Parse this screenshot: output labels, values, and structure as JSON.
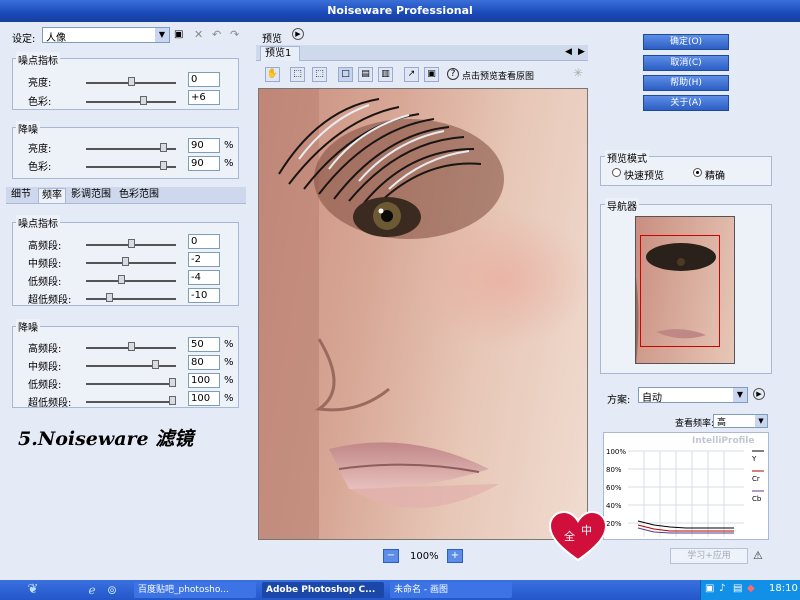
{
  "window": {
    "title": "Noiseware Professional"
  },
  "left": {
    "settings_label": "设定:",
    "preset_value": "人像",
    "noise_level_group": "噪点指标",
    "noise_reduction_group": "降噪",
    "luminance": "亮度:",
    "color": "色彩:",
    "noise_luminance_value": "0",
    "noise_color_value": "+6",
    "reduction_luminance_value": "90",
    "reduction_color_value": "90",
    "percent": "%",
    "tabs": [
      "细节",
      "频率",
      "影调范围",
      "色彩范围"
    ],
    "freq_noise_group": "噪点指标",
    "freq_reduction_group": "降噪",
    "high": "高频段:",
    "mid": "中频段:",
    "low": "低频段:",
    "ultra_low": "超低频段:",
    "freq_noise_values": [
      "0",
      "-2",
      "-4",
      "-10"
    ],
    "freq_reduction_values": [
      "50",
      "80",
      "100",
      "100"
    ],
    "caption": "5.Noiseware 滤镜"
  },
  "preview": {
    "header": "预览",
    "tab": "预览1",
    "hint": "点击预览查看原图",
    "zoom": "100%"
  },
  "right": {
    "buttons": [
      "确定(O)",
      "取消(C)",
      "帮助(H)",
      "关于(A)"
    ],
    "mode_group": "预览模式",
    "fast_preview": "快速预览",
    "accurate": "精确",
    "navigator": "导航器",
    "scheme_label": "方案:",
    "scheme_value": "自动",
    "freq_label": "查看频率:",
    "freq_value": "高",
    "graph_title": "IntelliProfile",
    "y_ticks": [
      "100%",
      "80%",
      "60%",
      "40%",
      "20%"
    ],
    "legend": [
      "Y",
      "Cr",
      "Cb"
    ],
    "learn_button": "学习+应用"
  },
  "taskbar": {
    "tasks": [
      "百度贴吧_photosho...",
      "Adobe Photoshop C...",
      "未命名 - 画图"
    ],
    "clock": "18:10"
  },
  "colors": {
    "title": "#1a4ab8",
    "accent_button": "#2c5fc4",
    "panel": "#e5ebf6",
    "graph_red": "#b00000",
    "graph_purple": "#5a3a8c"
  }
}
